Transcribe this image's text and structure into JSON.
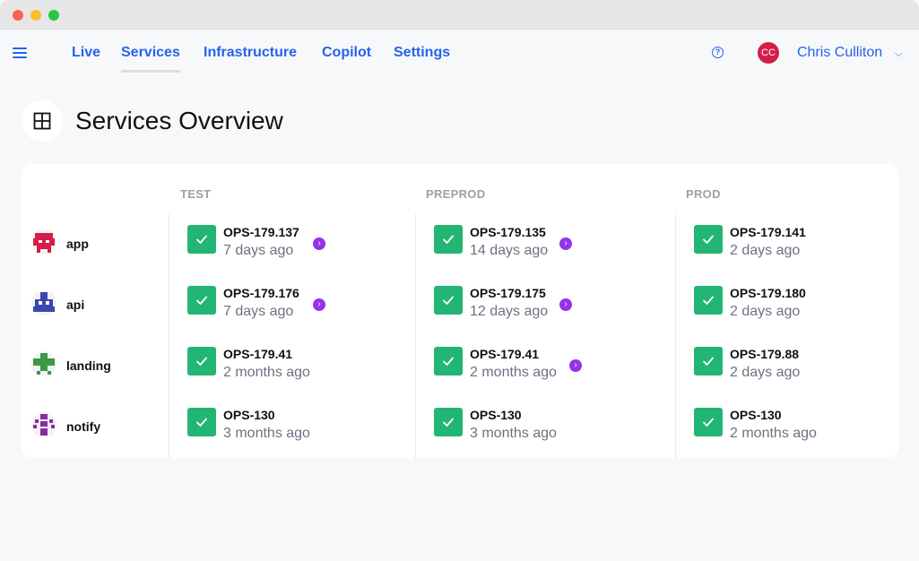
{
  "nav": {
    "tabs": [
      {
        "label": "Live"
      },
      {
        "label": "Services"
      },
      {
        "label": "Infrastructure"
      },
      {
        "label": "Copilot"
      },
      {
        "label": "Settings"
      }
    ],
    "active_tab": "Services",
    "help_glyph": "?",
    "user": {
      "initials": "CC",
      "name": "Chris Culliton",
      "avatar_color": "#d41e4a"
    }
  },
  "page": {
    "title": "Services Overview",
    "icon": "grid-icon"
  },
  "environments": [
    "TEST",
    "PREPROD",
    "PROD"
  ],
  "services": [
    {
      "name": "app",
      "icon_color": "#d41e4a"
    },
    {
      "name": "api",
      "icon_color": "#3b47b0"
    },
    {
      "name": "landing",
      "icon_color": "#3a9a45"
    },
    {
      "name": "notify",
      "icon_color": "#8a2a9e"
    }
  ],
  "deployments": [
    [
      {
        "version": "OPS-179.137",
        "age": "7 days ago",
        "promote": true
      },
      {
        "version": "OPS-179.135",
        "age": "14 days ago",
        "promote": true
      },
      {
        "version": "OPS-179.141",
        "age": "2 days ago",
        "promote": false
      }
    ],
    [
      {
        "version": "OPS-179.176",
        "age": "7 days ago",
        "promote": true
      },
      {
        "version": "OPS-179.175",
        "age": "12 days ago",
        "promote": true
      },
      {
        "version": "OPS-179.180",
        "age": "2 days ago",
        "promote": false
      }
    ],
    [
      {
        "version": "OPS-179.41",
        "age": "2 months ago",
        "promote": false
      },
      {
        "version": "OPS-179.41",
        "age": "2 months ago",
        "promote": true
      },
      {
        "version": "OPS-179.88",
        "age": "2 days ago",
        "promote": false
      }
    ],
    [
      {
        "version": "OPS-130",
        "age": "3 months ago",
        "promote": false
      },
      {
        "version": "OPS-130",
        "age": "3 months ago",
        "promote": false
      },
      {
        "version": "OPS-130",
        "age": "2 months ago",
        "promote": false
      }
    ]
  ],
  "colors": {
    "accent": "#2563eb",
    "success": "#22b573",
    "promote": "#9333ea"
  }
}
